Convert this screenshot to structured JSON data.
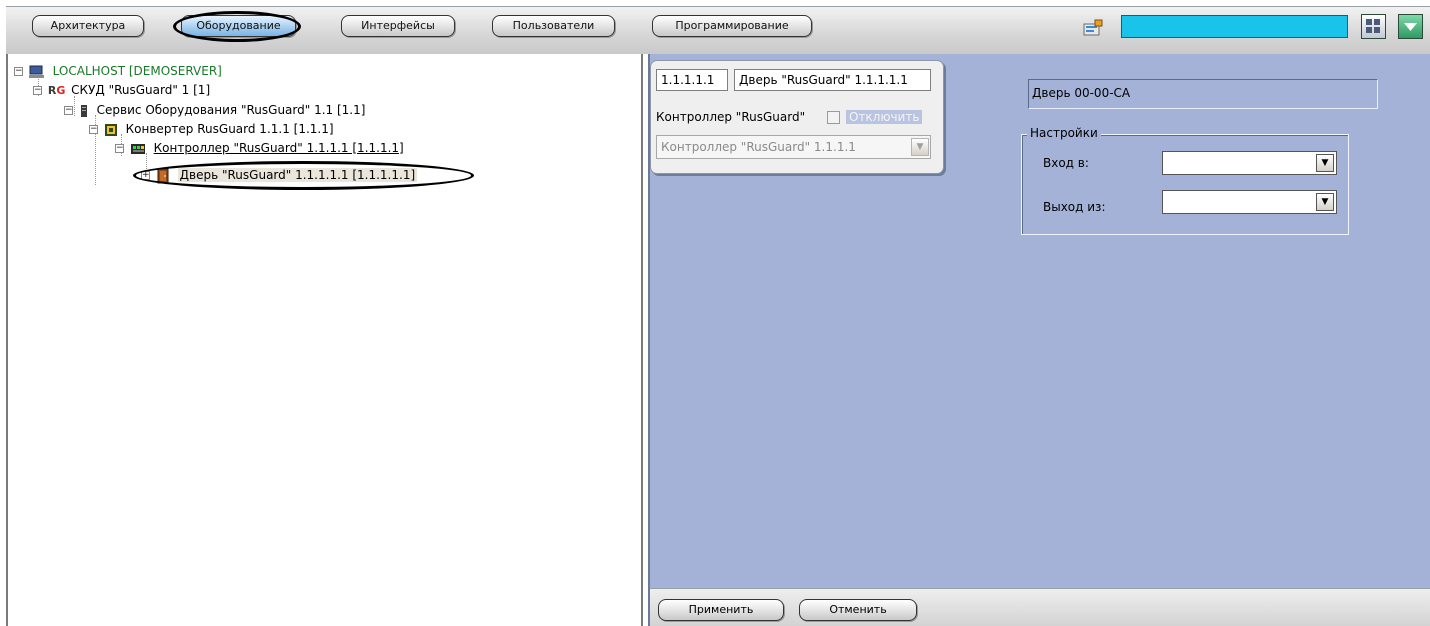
{
  "top_tabs": [
    {
      "label": "Архитектура",
      "active": false
    },
    {
      "label": "Оборудование",
      "active": true
    },
    {
      "label": "Интерфейсы",
      "active": false
    },
    {
      "label": "Пользователи",
      "active": false
    },
    {
      "label": "Программирование",
      "active": false
    }
  ],
  "toolbar": {
    "search_field_color": "#19c3ea",
    "icons": [
      "notes-icon",
      "layout-grid-icon",
      "dropdown-arrow-icon"
    ]
  },
  "tree": {
    "nodes": [
      {
        "label": "LOCALHOST [DEMOSERVER]",
        "icon": "computer-icon",
        "color": "#1a7a2a"
      },
      {
        "label_prefix": "RG",
        "label": "СКУД \"RusGuard\" 1 [1]",
        "icon": "rg-logo-icon"
      },
      {
        "label": "Сервис Оборудования \"RusGuard\" 1.1 [1.1]",
        "icon": "service-icon"
      },
      {
        "label": "Конвертер RusGuard 1.1.1 [1.1.1]",
        "icon": "converter-icon"
      },
      {
        "label": "Контроллер \"RusGuard\" 1.1.1.1 [1.1.1.1]",
        "icon": "controller-icon"
      },
      {
        "label": "Дверь \"RusGuard\" 1.1.1.1.1 [1.1.1.1.1]",
        "icon": "door-icon",
        "selected": true
      }
    ]
  },
  "object_card": {
    "id_value": "1.1.1.1.1",
    "name_value": "Дверь \"RusGuard\" 1.1.1.1.1",
    "parent_label": "Контроллер \"RusGuard\"",
    "disable_label": "Отключить",
    "parent_select_value": "Контроллер \"RusGuard\" 1.1.1.1"
  },
  "settings": {
    "door_name_value": "Дверь 00-00-CA",
    "group_title": "Настройки",
    "entry_label": "Вход в:",
    "entry_value": "",
    "exit_label": "Выход из:",
    "exit_value": ""
  },
  "bottom_buttons": {
    "apply_label": "Применить",
    "cancel_label": "Отменить"
  },
  "colors": {
    "panel_background": "#a4b2d8",
    "active_tab": "#a9cff0"
  }
}
